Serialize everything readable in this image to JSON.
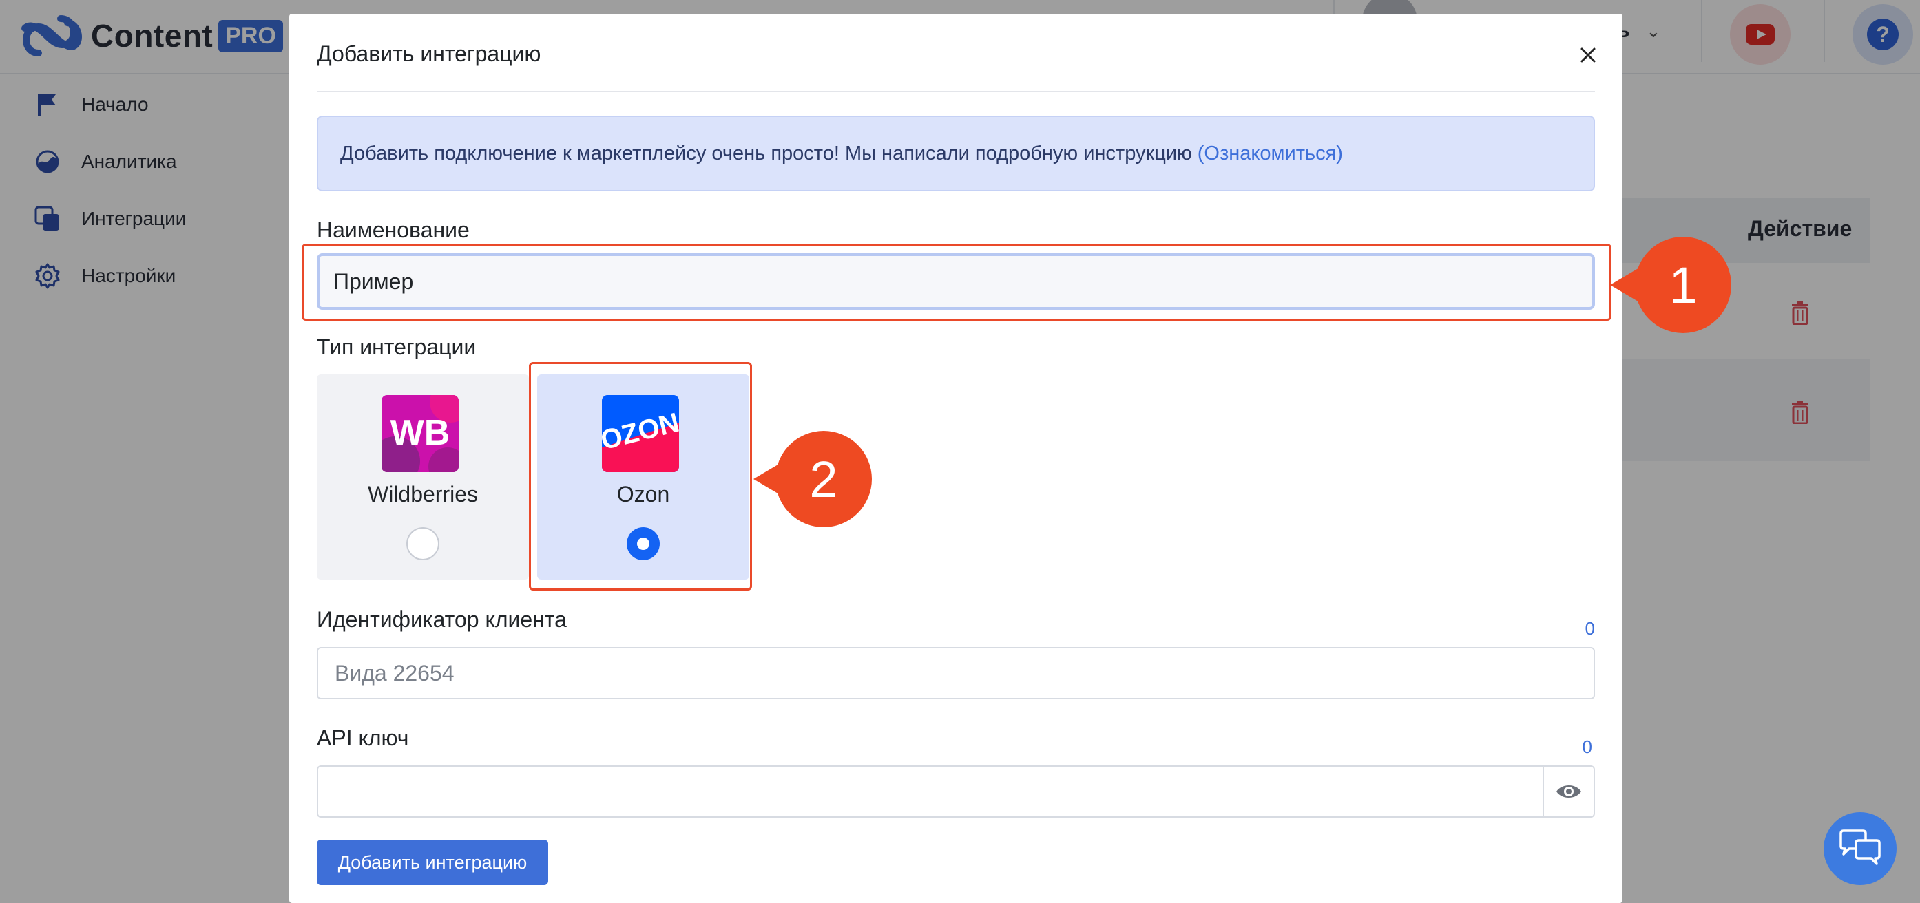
{
  "app": {
    "logo_text": "Content",
    "logo_badge": "PRO",
    "user_name_tail": "ь",
    "help_label": "?"
  },
  "sidebar": {
    "items": [
      {
        "label": "Начало",
        "icon": "flag-icon"
      },
      {
        "label": "Аналитика",
        "icon": "analytics-icon"
      },
      {
        "label": "Интеграции",
        "icon": "integrations-icon"
      },
      {
        "label": "Настройки",
        "icon": "gear-icon"
      }
    ]
  },
  "background_table": {
    "action_header": "Действие"
  },
  "modal": {
    "title": "Добавить интеграцию",
    "info_text": "Добавить подключение к маркетплейсу очень просто! Мы написали подробную инструкцию",
    "info_link": "(Ознакомиться)",
    "name_label": "Наименование",
    "name_value": "Пример",
    "type_label": "Тип интеграции",
    "types": [
      {
        "name": "Wildberries",
        "logo_text": "WB",
        "selected": false
      },
      {
        "name": "Ozon",
        "logo_text": "OZON",
        "selected": true
      }
    ],
    "client_id_label": "Идентификатор клиента",
    "client_id_counter": "0",
    "client_id_placeholder": "Вида 22654",
    "api_key_label": "API ключ",
    "api_key_counter": "0",
    "api_key_value": "",
    "submit_label": "Добавить интеграцию"
  },
  "annotations": {
    "callout_1": "1",
    "callout_2": "2",
    "accent_color": "#ee4a22"
  },
  "colors": {
    "primary": "#3e6fd8",
    "radio_selected": "#1463f3",
    "ozon_blue": "#005bff",
    "ozon_pink": "#f91155",
    "wb_magenta": "#cb11ab"
  }
}
